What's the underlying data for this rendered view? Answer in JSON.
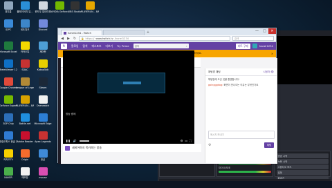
{
  "desktop": {
    "icons": [
      {
        "label": "휴지통",
        "color": "#8fa6bd"
      },
      {
        "label": "플레이어지 유...",
        "color": "#2a8ed6"
      },
      {
        "label": "윈도우 업데이트",
        "color": "#d0d7df"
      },
      {
        "label": "NVIDIA GeForce...",
        "color": "#73b900"
      },
      {
        "label": "OBS Studio",
        "color": "#333333"
      },
      {
        "label": "PLAYERUN... BATTLEGR...",
        "color": "#e6a700"
      },
      {
        "label": "내 PC",
        "color": "#3a8ad8"
      },
      {
        "label": "네트워크",
        "color": "#3d86c9"
      },
      {
        "label": "Discord",
        "color": "#7289da"
      },
      {
        "label": "Microsoft Excel 2010",
        "color": "#1f7a3e"
      },
      {
        "label": "카카오톡",
        "color": "#f4d800"
      },
      {
        "label": "제어판",
        "color": "#4d9ed6"
      },
      {
        "label": "TeamViewer 12",
        "color": "#0e6fc4"
      },
      {
        "label": "SDAC",
        "color": "#c73232"
      },
      {
        "label": "KakaoTalk",
        "color": "#e6cf00"
      },
      {
        "label": "Google Chrome",
        "color": "#e04a3a"
      },
      {
        "label": "League of Legends",
        "color": "#b48a36"
      },
      {
        "label": "Steam",
        "color": "#1b2838"
      },
      {
        "label": "GeForce Experience",
        "color": "#76b900"
      },
      {
        "label": "PLAYERUN... BATTLEGR...",
        "color": "#d8a200"
      },
      {
        "label": "Overwatch",
        "color": "#f0f0f0"
      },
      {
        "label": "3DP Chip",
        "color": "#2c6fb8"
      },
      {
        "label": "Battle.net",
        "color": "#1f8fde"
      },
      {
        "label": "Microsoft Edge",
        "color": "#2d7fd6"
      },
      {
        "label": "한컴오피스 한글 2014",
        "color": "#2f7bd2"
      },
      {
        "label": "Adobe Reader",
        "color": "#c8102e"
      },
      {
        "label": "Apex Legends",
        "color": "#c73232"
      },
      {
        "label": "카카오TV",
        "color": "#f6d000"
      },
      {
        "label": "Origin",
        "color": "#f56c2d"
      },
      {
        "label": "한글",
        "color": "#3f8ad8"
      },
      {
        "label": "NAVER",
        "color": "#4bb04b"
      },
      {
        "label": "메모장",
        "color": "#f2f2f2"
      },
      {
        "label": "mouse",
        "color": "#d94eb2"
      }
    ]
  },
  "browser": {
    "tabs": [
      {
        "title": "hanel1234 - Twitch",
        "active": true
      },
      {
        "title": "",
        "active": false
      }
    ],
    "url_prefix": "https://",
    "url_domain": "www.twitch.tv",
    "url_path": "/hanel1234",
    "search_placeholder": "검색",
    "window_controls": [
      "—",
      "□",
      "✕"
    ]
  },
  "twitch": {
    "nav": [
      "팔로잉",
      "탐색",
      "에스포츠",
      "더보기"
    ],
    "prime_label": "Try Prime",
    "search_placeholder": "검색",
    "turbo_label": "비트 구매",
    "user_name": "hanel1234",
    "user_status": "온라인",
    "banner_text": "계정 보안을 확인하고 이메일(hanel@gmail.com)을 인증하세요.",
    "channel_name": "hanel1234",
    "channel_tabs": [
      "동영상 0",
      "클립",
      "컬렉션",
      "이벤트",
      "팔로워"
    ],
    "video_caption": "방송 중에",
    "stream_title": "세비어하지 목키하는 방송",
    "chat_header": "채팅방 채팅",
    "chat_header_right": "시청자 👁",
    "chat_messages": [
      {
        "user": "",
        "text": "채팅방에 오신 것을 환영합니다!"
      },
      {
        "user": "goingggdog:",
        "text": "화면이 안나오는 이유는 무엇인가요"
      }
    ],
    "chat_placeholder": "메시지 보내기",
    "chat_send": "채팅"
  },
  "obs": {
    "sources_title": "소스 목록",
    "source_item": "디스플레이 캡처",
    "mixer_title": "오디오 믹서",
    "mixer_tracks": [
      "데스크톱 오디오",
      "마이크/보조"
    ],
    "controls": [
      "방송 시작",
      "녹화 시작",
      "스튜디오 모드",
      "설정",
      "끝내기"
    ],
    "status": "LIVE: 00:00:00   REC: 00:00:00   CPU: 7.9%, 60.00 fps"
  }
}
